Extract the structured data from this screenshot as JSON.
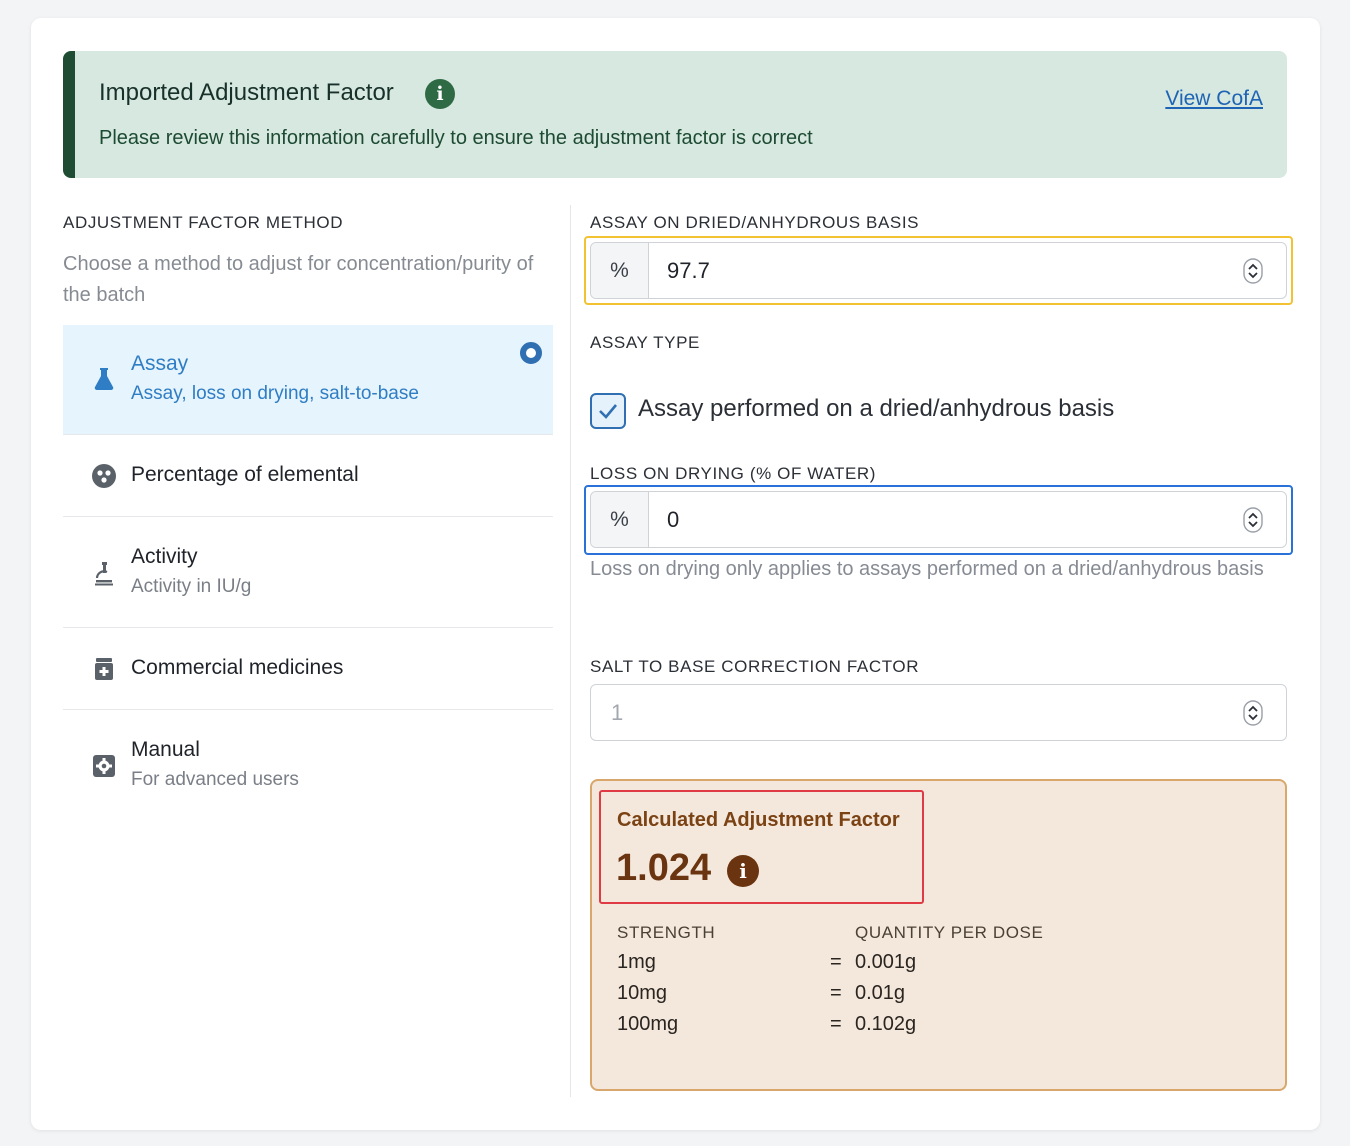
{
  "banner": {
    "title": "Imported Adjustment Factor",
    "message": "Please review this information carefully to ensure the adjustment factor is correct",
    "link": "View CofA"
  },
  "method_section": {
    "label": "ADJUSTMENT FACTOR METHOD",
    "description": "Choose a method to adjust for concentration/purity of the batch",
    "items": [
      {
        "title": "Assay",
        "subtitle": "Assay, loss on drying, salt-to-base",
        "icon": "flask-icon",
        "selected": true
      },
      {
        "title": "Percentage of elemental",
        "subtitle": "",
        "icon": "elemental-icon"
      },
      {
        "title": "Activity",
        "subtitle": "Activity in IU/g",
        "icon": "microscope-icon"
      },
      {
        "title": "Commercial medicines",
        "subtitle": "",
        "icon": "medicine-bottle-icon"
      },
      {
        "title": "Manual",
        "subtitle": "For advanced users",
        "icon": "cog-icon"
      }
    ]
  },
  "fields": {
    "assay": {
      "label": "ASSAY ON DRIED/ANHYDROUS BASIS",
      "prefix": "%",
      "value": "97.7"
    },
    "assay_type": {
      "label": "ASSAY TYPE",
      "checkbox_label": "Assay performed on a dried/anhydrous basis",
      "checked": true
    },
    "loss_on_drying": {
      "label": "LOSS ON DRYING (% OF WATER)",
      "prefix": "%",
      "value": "0",
      "help": "Loss on drying only applies to assays performed on a dried/anhydrous basis"
    },
    "salt_to_base": {
      "label": "SALT TO BASE CORRECTION FACTOR",
      "placeholder": "1"
    }
  },
  "result": {
    "title": "Calculated Adjustment Factor",
    "value": "1.024",
    "headers": {
      "strength": "STRENGTH",
      "quantity": "QUANTITY PER DOSE"
    },
    "rows": [
      {
        "strength": "1mg",
        "eq": "=",
        "quantity": "0.001g"
      },
      {
        "strength": "10mg",
        "eq": "=",
        "quantity": "0.01g"
      },
      {
        "strength": "100mg",
        "eq": "=",
        "quantity": "0.102g"
      }
    ]
  },
  "colors": {
    "banner_bg": "#d6e8df",
    "banner_accent": "#1e4d33",
    "selected_bg": "#e6f4fd",
    "link": "#1f63b5",
    "result_bg": "#f4e8dc",
    "result_text": "#6a3410",
    "highlight_red": "#e03a45",
    "focus_yellow": "#f2c233",
    "focus_blue": "#2a72d9"
  }
}
